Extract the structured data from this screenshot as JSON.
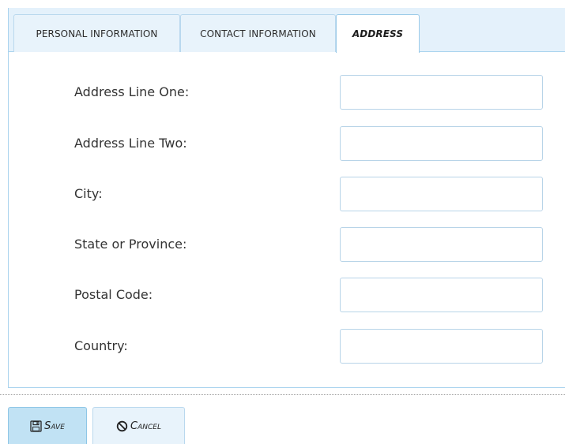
{
  "tabs": [
    {
      "label": "PERSONAL INFORMATION",
      "active": false
    },
    {
      "label": "CONTACT INFORMATION",
      "active": false
    },
    {
      "label": "ADDRESS",
      "active": true
    }
  ],
  "form": {
    "address_line_one": {
      "label": "Address Line One:",
      "value": ""
    },
    "address_line_two": {
      "label": "Address Line Two:",
      "value": ""
    },
    "city": {
      "label": "City:",
      "value": ""
    },
    "state": {
      "label": "State or Province:",
      "value": ""
    },
    "postal_code": {
      "label": "Postal Code:",
      "value": ""
    },
    "country": {
      "label": "Country:",
      "value": ""
    }
  },
  "actions": {
    "save_label": "Save",
    "save_icon": "floppy-disk-icon",
    "cancel_label": "Cancel",
    "cancel_icon": "prohibited-icon"
  },
  "colors": {
    "tab_strip_bg": "#e4f1fb",
    "border": "#a9d3ee",
    "save_bg": "#c1e2f4"
  }
}
